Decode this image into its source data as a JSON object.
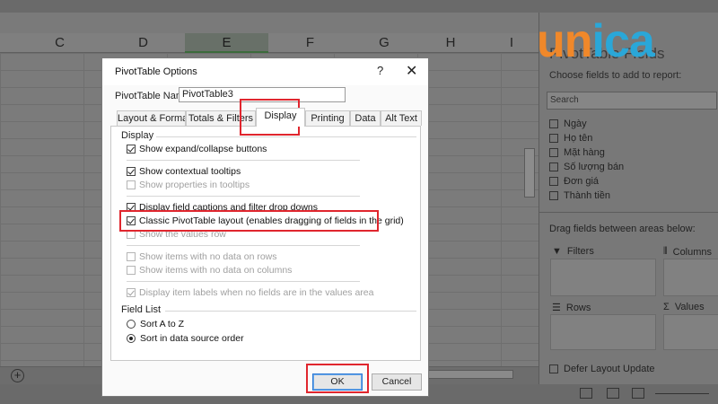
{
  "excel": {
    "columns": [
      "C",
      "D",
      "E",
      "F",
      "G",
      "H",
      "I"
    ],
    "add_sheet_symbol": "+"
  },
  "logo": {
    "part1": "un",
    "part2": "ica"
  },
  "pane": {
    "title": "PivotTable Fields",
    "subtitle": "Choose fields to add to report:",
    "search_placeholder": "Search",
    "fields": [
      "Ngày",
      "Họ tên",
      "Mặt hàng",
      "Số lượng bán",
      "Đơn giá",
      "Thành tiền"
    ],
    "drag_text": "Drag fields between areas below:",
    "areas": {
      "filters": "Filters",
      "columns": "Columns",
      "rows": "Rows",
      "values": "Values"
    },
    "defer_label": "Defer Layout Update"
  },
  "dialog": {
    "title": "PivotTable Options",
    "help": "?",
    "close": "✕",
    "name_label": "PivotTable Name:",
    "name_value": "PivotTable3",
    "tabs": [
      "Layout & Format",
      "Totals & Filters",
      "Display",
      "Printing",
      "Data",
      "Alt Text"
    ],
    "active_tab": "Display",
    "display_section": "Display",
    "options": [
      {
        "label": "Show expand/collapse buttons",
        "checked": true,
        "enabled": true
      },
      {
        "label": "Show contextual tooltips",
        "checked": true,
        "enabled": true
      },
      {
        "label": "Show properties in tooltips",
        "checked": false,
        "enabled": false
      },
      {
        "label": "Display field captions and filter drop downs",
        "checked": true,
        "enabled": true
      },
      {
        "label": "Classic PivotTable layout (enables dragging of fields in the grid)",
        "checked": true,
        "enabled": true
      },
      {
        "label": "Show the values row",
        "checked": false,
        "enabled": false
      },
      {
        "label": "Show items with no data on rows",
        "checked": false,
        "enabled": false
      },
      {
        "label": "Show items with no data on columns",
        "checked": false,
        "enabled": false
      },
      {
        "label": "Display item labels when no fields are in the values area",
        "checked": true,
        "enabled": false
      }
    ],
    "field_list_section": "Field List",
    "sort_options": [
      {
        "label": "Sort A to Z",
        "selected": false
      },
      {
        "label": "Sort in data source order",
        "selected": true
      }
    ],
    "ok_label": "OK",
    "cancel_label": "Cancel"
  },
  "highlight_color": "#e0262e"
}
